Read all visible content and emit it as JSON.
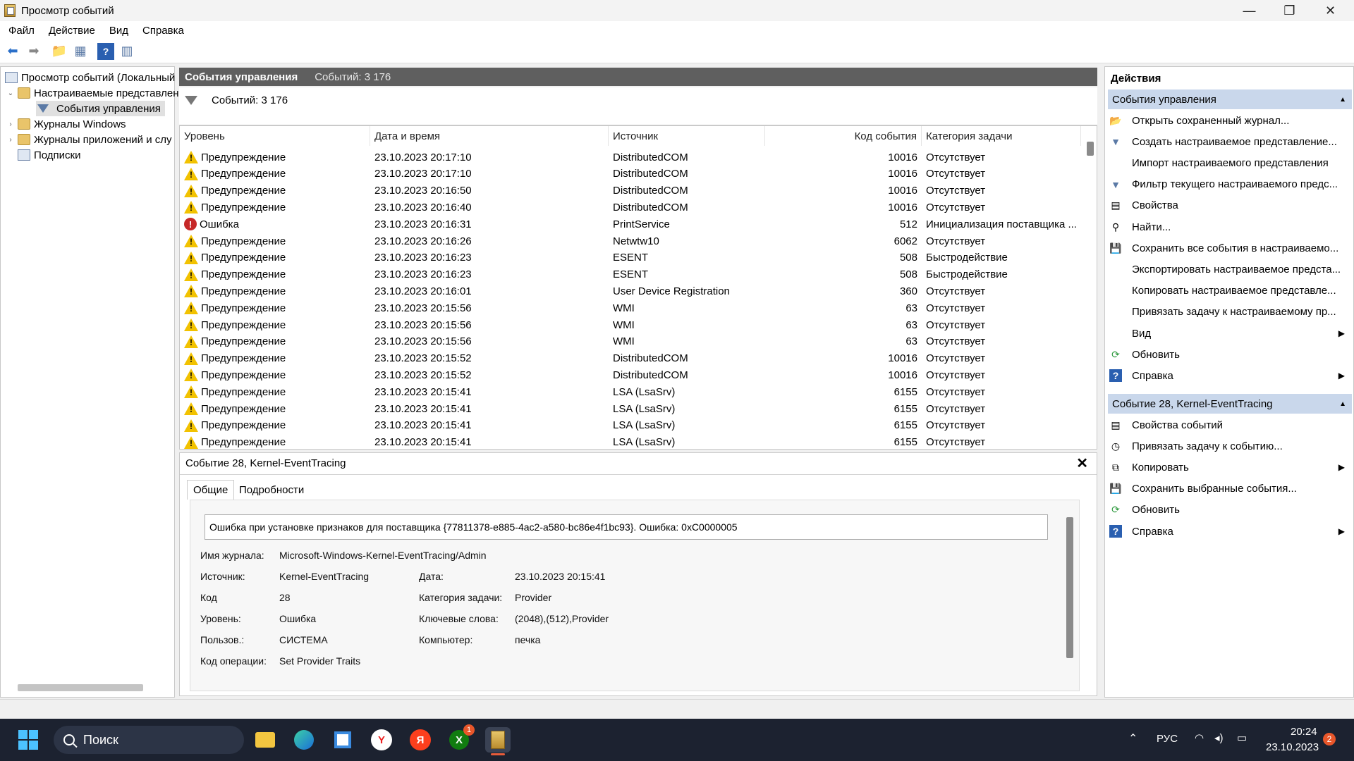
{
  "window": {
    "title": "Просмотр событий"
  },
  "menu": [
    "Файл",
    "Действие",
    "Вид",
    "Справка"
  ],
  "tree": {
    "root": "Просмотр событий (Локальный",
    "custom_views": "Настраиваемые представлен",
    "admin_events": "События управления",
    "windows_logs": "Журналы Windows",
    "app_logs": "Журналы приложений и слу",
    "subscriptions": "Подписки"
  },
  "center": {
    "title": "События управления",
    "count_header": "Событий: 3 176",
    "filter_count": "Событий: 3 176"
  },
  "table": {
    "columns": [
      "Уровень",
      "Дата и время",
      "Источник",
      "Код события",
      "Категория задачи"
    ],
    "rows": [
      {
        "level": "Предупреждение",
        "type": "warn",
        "date": "23.10.2023 20:17:10",
        "source": "DistributedCOM",
        "code": "10016",
        "category": "Отсутствует"
      },
      {
        "level": "Предупреждение",
        "type": "warn",
        "date": "23.10.2023 20:17:10",
        "source": "DistributedCOM",
        "code": "10016",
        "category": "Отсутствует"
      },
      {
        "level": "Предупреждение",
        "type": "warn",
        "date": "23.10.2023 20:16:50",
        "source": "DistributedCOM",
        "code": "10016",
        "category": "Отсутствует"
      },
      {
        "level": "Предупреждение",
        "type": "warn",
        "date": "23.10.2023 20:16:40",
        "source": "DistributedCOM",
        "code": "10016",
        "category": "Отсутствует"
      },
      {
        "level": "Ошибка",
        "type": "err",
        "date": "23.10.2023 20:16:31",
        "source": "PrintService",
        "code": "512",
        "category": "Инициализация поставщика ..."
      },
      {
        "level": "Предупреждение",
        "type": "warn",
        "date": "23.10.2023 20:16:26",
        "source": "Netwtw10",
        "code": "6062",
        "category": "Отсутствует"
      },
      {
        "level": "Предупреждение",
        "type": "warn",
        "date": "23.10.2023 20:16:23",
        "source": "ESENT",
        "code": "508",
        "category": "Быстродействие"
      },
      {
        "level": "Предупреждение",
        "type": "warn",
        "date": "23.10.2023 20:16:23",
        "source": "ESENT",
        "code": "508",
        "category": "Быстродействие"
      },
      {
        "level": "Предупреждение",
        "type": "warn",
        "date": "23.10.2023 20:16:01",
        "source": "User Device Registration",
        "code": "360",
        "category": "Отсутствует"
      },
      {
        "level": "Предупреждение",
        "type": "warn",
        "date": "23.10.2023 20:15:56",
        "source": "WMI",
        "code": "63",
        "category": "Отсутствует"
      },
      {
        "level": "Предупреждение",
        "type": "warn",
        "date": "23.10.2023 20:15:56",
        "source": "WMI",
        "code": "63",
        "category": "Отсутствует"
      },
      {
        "level": "Предупреждение",
        "type": "warn",
        "date": "23.10.2023 20:15:56",
        "source": "WMI",
        "code": "63",
        "category": "Отсутствует"
      },
      {
        "level": "Предупреждение",
        "type": "warn",
        "date": "23.10.2023 20:15:52",
        "source": "DistributedCOM",
        "code": "10016",
        "category": "Отсутствует"
      },
      {
        "level": "Предупреждение",
        "type": "warn",
        "date": "23.10.2023 20:15:52",
        "source": "DistributedCOM",
        "code": "10016",
        "category": "Отсутствует"
      },
      {
        "level": "Предупреждение",
        "type": "warn",
        "date": "23.10.2023 20:15:41",
        "source": "LSA (LsaSrv)",
        "code": "6155",
        "category": "Отсутствует"
      },
      {
        "level": "Предупреждение",
        "type": "warn",
        "date": "23.10.2023 20:15:41",
        "source": "LSA (LsaSrv)",
        "code": "6155",
        "category": "Отсутствует"
      },
      {
        "level": "Предупреждение",
        "type": "warn",
        "date": "23.10.2023 20:15:41",
        "source": "LSA (LsaSrv)",
        "code": "6155",
        "category": "Отсутствует"
      },
      {
        "level": "Предупреждение",
        "type": "warn",
        "date": "23.10.2023 20:15:41",
        "source": "LSA (LsaSrv)",
        "code": "6155",
        "category": "Отсутствует"
      }
    ]
  },
  "detail": {
    "title": "Событие 28, Kernel-EventTracing",
    "tabs": [
      "Общие",
      "Подробности"
    ],
    "message": "Ошибка при установке признаков для поставщика {77811378-e885-4ac2-a580-bc86e4f1bc93}. Ошибка: 0xC0000005",
    "labels": {
      "log": "Имя журнала:",
      "source": "Источник:",
      "code": "Код",
      "level": "Уровень:",
      "user": "Пользов.:",
      "opcode": "Код операции:",
      "date": "Дата:",
      "category": "Категория задачи:",
      "keywords": "Ключевые слова:",
      "computer": "Компьютер:"
    },
    "values": {
      "log": "Microsoft-Windows-Kernel-EventTracing/Admin",
      "source": "Kernel-EventTracing",
      "code": "28",
      "level": "Ошибка",
      "user": "СИСТЕМА",
      "opcode": "Set Provider Traits",
      "date": "23.10.2023 20:15:41",
      "category": "Provider",
      "keywords": "(2048),(512),Provider",
      "computer": "печка"
    }
  },
  "actions": {
    "header": "Действия",
    "section1": "События управления",
    "items1": [
      {
        "label": "Открыть сохраненный журнал...",
        "icon": "folder-open-icon",
        "glyph": "📂"
      },
      {
        "label": "Создать настраиваемое представление...",
        "icon": "filter-icon",
        "glyph": "▼"
      },
      {
        "label": "Импорт настраиваемого представления",
        "icon": "",
        "glyph": ""
      },
      {
        "label": "Фильтр текущего настраиваемого предс...",
        "icon": "filter-icon",
        "glyph": "▼"
      },
      {
        "label": "Свойства",
        "icon": "properties-icon",
        "glyph": "▤"
      },
      {
        "label": "Найти...",
        "icon": "binoculars-icon",
        "glyph": "⚲"
      },
      {
        "label": "Сохранить все события в настраиваемо...",
        "icon": "save-icon",
        "glyph": "💾"
      },
      {
        "label": "Экспортировать настраиваемое предста...",
        "icon": "",
        "glyph": ""
      },
      {
        "label": "Копировать настраиваемое представле...",
        "icon": "",
        "glyph": ""
      },
      {
        "label": "Привязать задачу к настраиваемому пр...",
        "icon": "",
        "glyph": ""
      },
      {
        "label": "Вид",
        "icon": "",
        "glyph": "",
        "submenu": true
      },
      {
        "label": "Обновить",
        "icon": "refresh-icon",
        "glyph": "⟳"
      },
      {
        "label": "Справка",
        "icon": "help-icon",
        "glyph": "?",
        "submenu": true
      }
    ],
    "section2": "Событие 28, Kernel-EventTracing",
    "items2": [
      {
        "label": "Свойства событий",
        "icon": "properties-icon",
        "glyph": "▤"
      },
      {
        "label": "Привязать задачу к событию...",
        "icon": "task-icon",
        "glyph": "◷"
      },
      {
        "label": "Копировать",
        "icon": "copy-icon",
        "glyph": "⧉",
        "submenu": true
      },
      {
        "label": "Сохранить выбранные события...",
        "icon": "save-icon",
        "glyph": "💾"
      },
      {
        "label": "Обновить",
        "icon": "refresh-icon",
        "glyph": "⟳"
      },
      {
        "label": "Справка",
        "icon": "help-icon",
        "glyph": "?",
        "submenu": true
      }
    ]
  },
  "taskbar": {
    "search": "Поиск",
    "lang": "РУС",
    "time": "20:24",
    "date": "23.10.2023",
    "notif_count": "2",
    "xbox_badge": "1"
  }
}
